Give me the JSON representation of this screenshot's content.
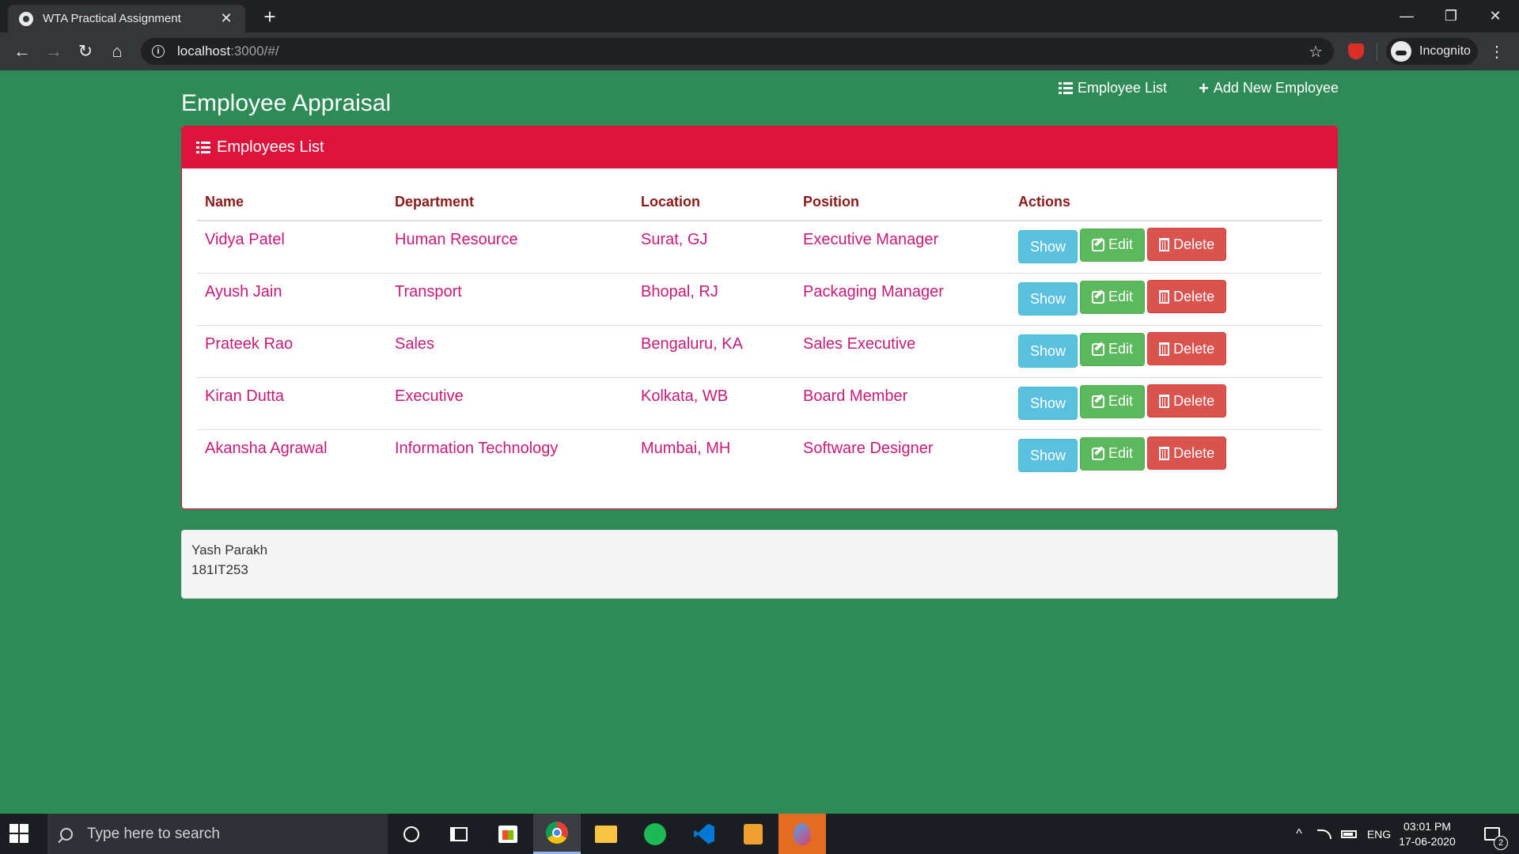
{
  "browser": {
    "tab_title": "WTA Practical Assignment",
    "tab_close": "✕",
    "new_tab": "+",
    "window_minimize": "—",
    "window_maximize": "❐",
    "window_close": "✕",
    "url_host": "localhost",
    "url_rest": ":3000/#/",
    "profile_label": "Incognito",
    "back": "←",
    "forward": "→",
    "reload": "↻",
    "home": "⌂",
    "star": "☆",
    "menu": "⋮"
  },
  "app": {
    "brand": "Employee Appraisal",
    "nav": {
      "employee_list": "Employee List",
      "add_new_employee": "Add New Employee"
    },
    "panel_title": "Employees List",
    "table": {
      "headers": [
        "Name",
        "Department",
        "Location",
        "Position",
        "Actions"
      ],
      "rows": [
        {
          "name": "Vidya Patel",
          "department": "Human Resource",
          "location": "Surat, GJ",
          "position": "Executive Manager"
        },
        {
          "name": "Ayush Jain",
          "department": "Transport",
          "location": "Bhopal, RJ",
          "position": "Packaging Manager"
        },
        {
          "name": "Prateek Rao",
          "department": "Sales",
          "location": "Bengaluru, KA",
          "position": "Sales Executive"
        },
        {
          "name": "Kiran Dutta",
          "department": "Executive",
          "location": "Kolkata, WB",
          "position": "Board Member"
        },
        {
          "name": "Akansha Agrawal",
          "department": "Information Technology",
          "location": "Mumbai, MH",
          "position": "Software Designer"
        }
      ],
      "actions": {
        "show": "Show",
        "edit": "Edit",
        "delete": "Delete"
      }
    },
    "footer": {
      "line1": "Yash Parakh",
      "line2": "181IT253"
    }
  },
  "taskbar": {
    "search_placeholder": "Type here to search",
    "lang": "ENG",
    "time": "03:01 PM",
    "date": "17-06-2020",
    "notification_count": "2",
    "tray_chevron": "^"
  },
  "colors": {
    "page_background": "#2e8b57",
    "panel_header": "#dc143c",
    "table_header_text": "#8b1a1a",
    "table_cell_text": "#c71b78",
    "btn_show": "#5bc0de",
    "btn_edit": "#5cb85c",
    "btn_delete": "#d9534f"
  }
}
